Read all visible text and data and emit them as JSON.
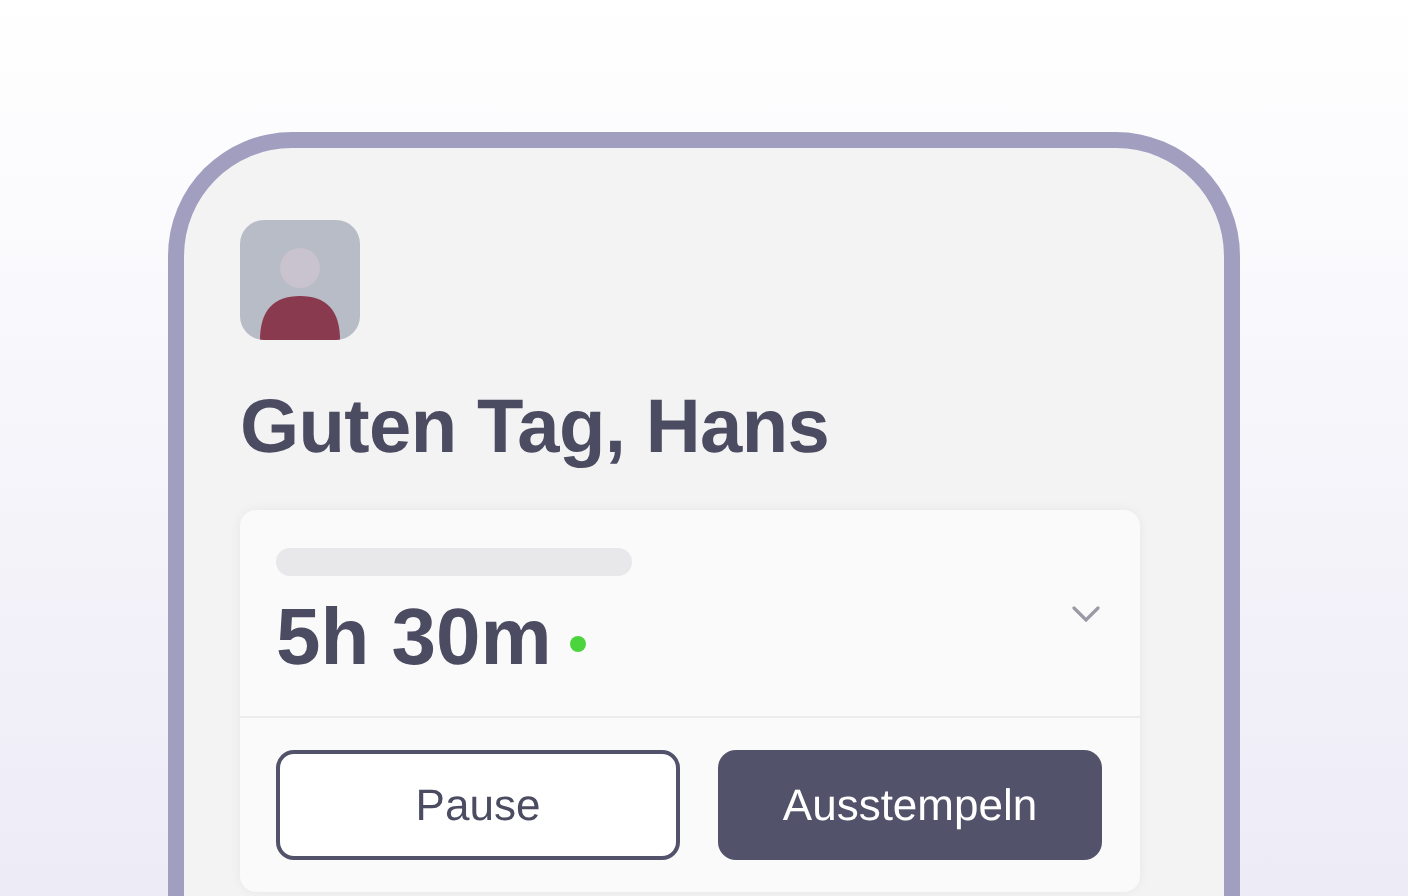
{
  "greeting": "Guten Tag, Hans",
  "timer": {
    "elapsed": "5h 30m",
    "running": true,
    "expanded": false
  },
  "buttons": [
    {
      "label": "Pause",
      "kind": "secondary"
    },
    {
      "label": "Ausstempeln",
      "kind": "primary"
    }
  ]
}
